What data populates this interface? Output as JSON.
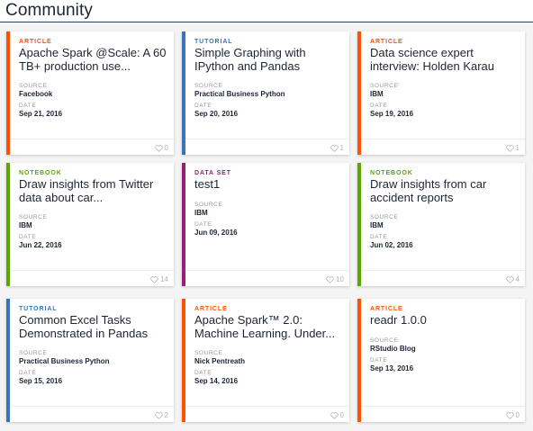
{
  "page": {
    "title": "Community"
  },
  "labels": {
    "source": "SOURCE",
    "date": "DATE"
  },
  "colors": {
    "ARTICLE": "#ff5003",
    "TUTORIAL": "#3b73b9",
    "NOTEBOOK": "#5aa700",
    "DATA SET": "#9b1d74"
  },
  "cards": [
    {
      "type": "ARTICLE",
      "title": "Apache Spark @Scale: A 60 TB+ production use...",
      "source": "Facebook",
      "date": "Sep 21, 2016",
      "likes": "0"
    },
    {
      "type": "TUTORIAL",
      "title": "Simple Graphing with IPython and Pandas",
      "source": "Practical Business Python",
      "date": "Sep 20, 2016",
      "likes": "1"
    },
    {
      "type": "ARTICLE",
      "title": "Data science expert interview: Holden Karau",
      "source": "IBM",
      "date": "Sep 19, 2016",
      "likes": "1"
    },
    {
      "type": "NOTEBOOK",
      "title": "Draw insights from Twitter data about car...",
      "source": "IBM",
      "date": "Jun 22, 2016",
      "likes": "14"
    },
    {
      "type": "DATA SET",
      "title": "test1",
      "source": "IBM",
      "date": "Jun 09, 2016",
      "likes": "10"
    },
    {
      "type": "NOTEBOOK",
      "title": "Draw insights from car accident reports",
      "source": "IBM",
      "date": "Jun 02, 2016",
      "likes": "4"
    },
    {
      "type": "TUTORIAL",
      "title": "Common Excel Tasks Demonstrated in Pandas",
      "source": "Practical Business Python",
      "date": "Sep 15, 2016",
      "likes": "2"
    },
    {
      "type": "ARTICLE",
      "title": "Apache Spark™ 2.0: Machine Learning. Under...",
      "source": "Nick Pentreath",
      "date": "Sep 14, 2016",
      "likes": "0"
    },
    {
      "type": "ARTICLE",
      "title": "readr 1.0.0",
      "source": "RStudio Blog",
      "date": "Sep 13, 2016",
      "likes": "0"
    }
  ]
}
